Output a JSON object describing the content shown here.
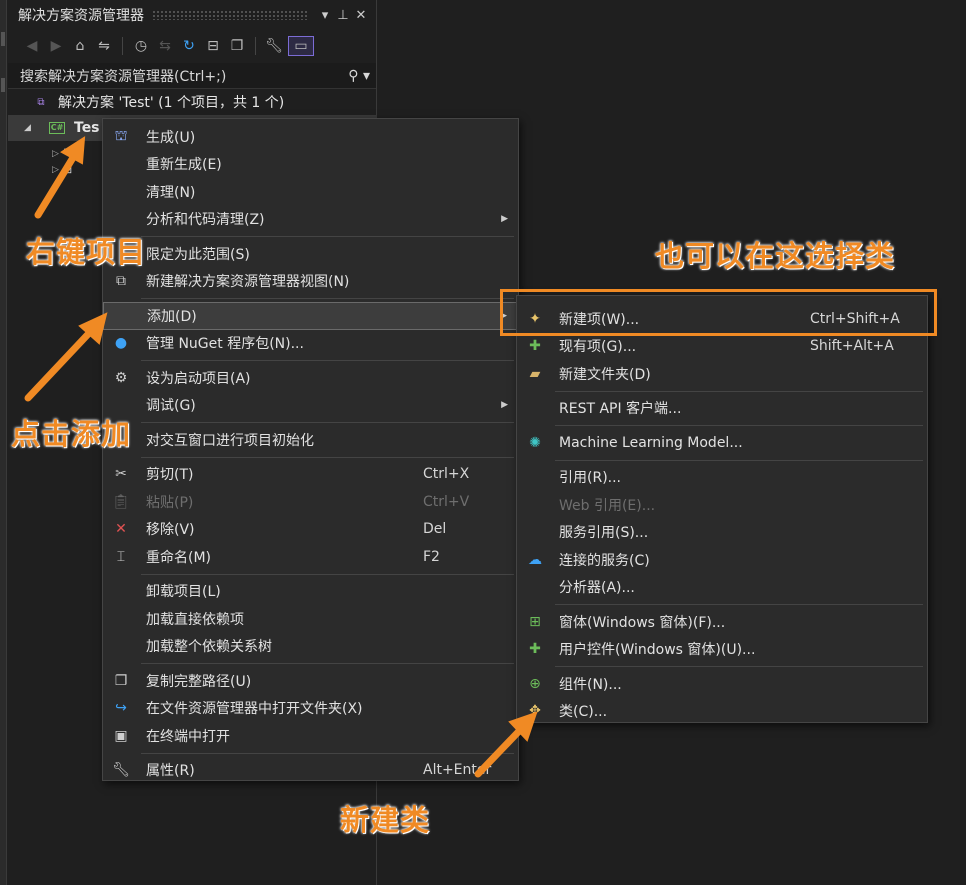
{
  "panel": {
    "title": "解决方案资源管理器",
    "search_placeholder": "搜索解决方案资源管理器(Ctrl+;)",
    "solution_label": "解决方案 'Test' (1 个项目，共 1 个)",
    "project_label": "Tes",
    "project_icon": "C#"
  },
  "context_menu": {
    "items": [
      {
        "label": "生成(U)",
        "shortcut": "",
        "icon": "build-icon"
      },
      {
        "label": "重新生成(E)",
        "shortcut": ""
      },
      {
        "label": "清理(N)",
        "shortcut": ""
      },
      {
        "label": "分析和代码清理(Z)",
        "shortcut": "",
        "submenu": true
      },
      {
        "label": "限定为此范围(S)",
        "shortcut": ""
      },
      {
        "label": "新建解决方案资源管理器视图(N)",
        "shortcut": ""
      },
      {
        "label": "添加(D)",
        "shortcut": "",
        "submenu": true
      },
      {
        "label": "管理 NuGet 程序包(N)...",
        "shortcut": ""
      },
      {
        "label": "设为启动项目(A)",
        "shortcut": ""
      },
      {
        "label": "调试(G)",
        "shortcut": "",
        "submenu": true
      },
      {
        "label": "对交互窗口进行项目初始化",
        "shortcut": ""
      },
      {
        "label": "剪切(T)",
        "shortcut": "Ctrl+X"
      },
      {
        "label": "粘贴(P)",
        "shortcut": "Ctrl+V"
      },
      {
        "label": "移除(V)",
        "shortcut": "Del"
      },
      {
        "label": "重命名(M)",
        "shortcut": "F2"
      },
      {
        "label": "卸载项目(L)",
        "shortcut": ""
      },
      {
        "label": "加载直接依赖项",
        "shortcut": ""
      },
      {
        "label": "加载整个依赖关系树",
        "shortcut": ""
      },
      {
        "label": "复制完整路径(U)",
        "shortcut": ""
      },
      {
        "label": "在文件资源管理器中打开文件夹(X)",
        "shortcut": ""
      },
      {
        "label": "在终端中打开",
        "shortcut": ""
      },
      {
        "label": "属性(R)",
        "shortcut": "Alt+Enter"
      }
    ]
  },
  "add_submenu": {
    "items": [
      {
        "label": "新建项(W)...",
        "shortcut": "Ctrl+Shift+A"
      },
      {
        "label": "现有项(G)...",
        "shortcut": "Shift+Alt+A"
      },
      {
        "label": "新建文件夹(D)",
        "shortcut": ""
      },
      {
        "label": "REST API 客户端...",
        "shortcut": ""
      },
      {
        "label": "Machine Learning Model...",
        "shortcut": ""
      },
      {
        "label": "引用(R)...",
        "shortcut": ""
      },
      {
        "label": "Web 引用(E)...",
        "shortcut": ""
      },
      {
        "label": "服务引用(S)...",
        "shortcut": ""
      },
      {
        "label": "连接的服务(C)",
        "shortcut": ""
      },
      {
        "label": "分析器(A)...",
        "shortcut": ""
      },
      {
        "label": "窗体(Windows 窗体)(F)...",
        "shortcut": ""
      },
      {
        "label": "用户控件(Windows 窗体)(U)...",
        "shortcut": ""
      },
      {
        "label": "组件(N)...",
        "shortcut": ""
      },
      {
        "label": "类(C)...",
        "shortcut": ""
      }
    ]
  },
  "annotations": {
    "right_click_project": "右键项目",
    "click_add": "点击添加",
    "also_select_class_here": "也可以在这选择类",
    "new_class": "新建类"
  },
  "colors": {
    "annotation": "#f08a24",
    "background": "#1f1f1f",
    "menu_bg": "#2b2b2b"
  }
}
